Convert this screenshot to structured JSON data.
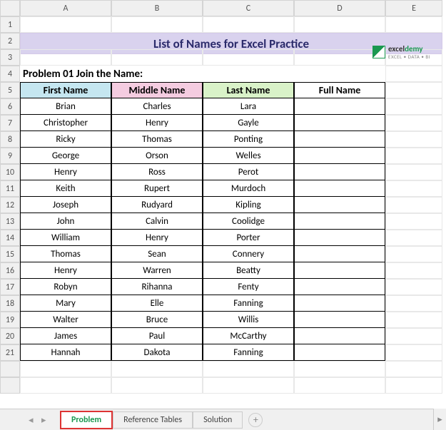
{
  "columns": [
    "A",
    "B",
    "C",
    "D",
    "E"
  ],
  "row_numbers": [
    "1",
    "2",
    "3",
    "4",
    "5",
    "6",
    "7",
    "8",
    "9",
    "10",
    "11",
    "12",
    "13",
    "14",
    "15",
    "16",
    "17",
    "18",
    "19",
    "20",
    "21"
  ],
  "title": "List of Names for Excel Practice",
  "problem_label": "Problem 01 Join the Name:",
  "headers": {
    "first": "First Name",
    "middle": "Middle Name",
    "last": "Last Name",
    "full": "Full Name"
  },
  "rows": [
    {
      "first": "Brian",
      "middle": "Charles",
      "last": "Lara"
    },
    {
      "first": "Christopher",
      "middle": "Henry",
      "last": "Gayle"
    },
    {
      "first": "Ricky",
      "middle": "Thomas",
      "last": "Ponting"
    },
    {
      "first": "George",
      "middle": "Orson",
      "last": "Welles"
    },
    {
      "first": "Henry",
      "middle": "Ross",
      "last": "Perot"
    },
    {
      "first": "Keith",
      "middle": "Rupert",
      "last": "Murdoch"
    },
    {
      "first": "Joseph",
      "middle": "Rudyard",
      "last": "Kipling"
    },
    {
      "first": "John",
      "middle": "Calvin",
      "last": "Coolidge"
    },
    {
      "first": "William",
      "middle": "Henry",
      "last": "Porter"
    },
    {
      "first": "Thomas",
      "middle": "Sean",
      "last": "Connery"
    },
    {
      "first": "Henry",
      "middle": "Warren",
      "last": "Beatty"
    },
    {
      "first": "Robyn",
      "middle": "Rihanna",
      "last": "Fenty"
    },
    {
      "first": "Mary",
      "middle": "Elle",
      "last": "Fanning"
    },
    {
      "first": "Walter",
      "middle": "Bruce",
      "last": "Willis"
    },
    {
      "first": "James",
      "middle": "Paul",
      "last": "McCarthy"
    },
    {
      "first": "Hannah",
      "middle": "Dakota",
      "last": "Fanning"
    }
  ],
  "logo": {
    "brand1": "excel",
    "brand2": "demy",
    "tagline": "EXCEL • DATA • BI"
  },
  "tabs": {
    "nav_prev": "◂",
    "nav_next": "▸",
    "sheets": [
      "Problem",
      "Reference Tables",
      "Solution"
    ],
    "active": 0,
    "add": "+",
    "scroll_right": "▸"
  }
}
